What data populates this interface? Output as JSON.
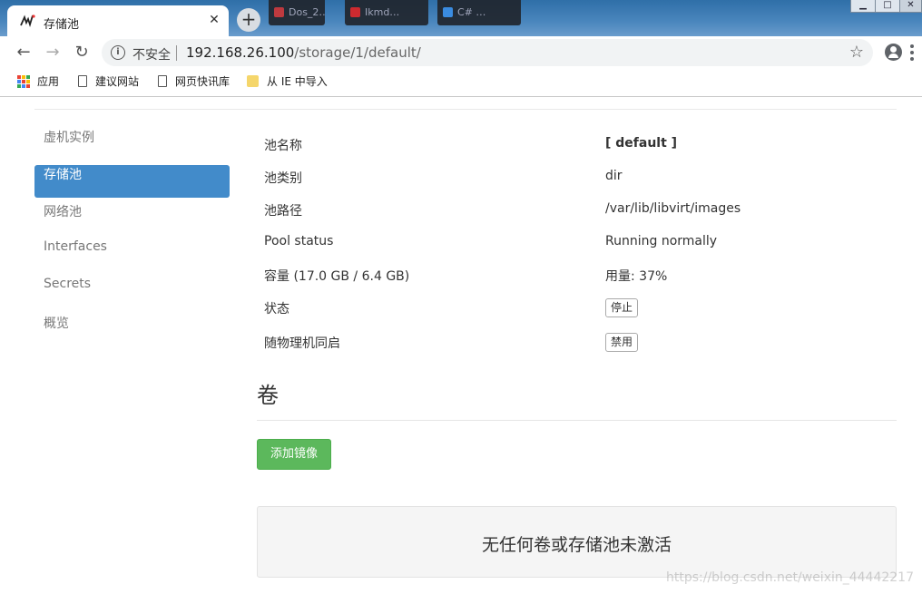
{
  "browser": {
    "tab_title": "存储池",
    "bg_tabs": [
      "Dos_2…",
      "Ikmd…",
      "C# …"
    ],
    "window_controls": [
      "▁",
      "□",
      "✕"
    ],
    "new_tab_label": "+",
    "address_security": "不安全",
    "address_host": "192.168.26.100",
    "address_path": "/storage/1/default/",
    "bookmarks": [
      "应用",
      "建议网站",
      "网页快讯库",
      "从 IE 中导入"
    ],
    "icons": {
      "back": "back-arrow-icon",
      "forward": "forward-arrow-icon",
      "reload": "reload-icon",
      "info": "info-icon",
      "star": "star-icon",
      "account": "account-icon",
      "menu": "menu-icon",
      "apps": "apps-grid-icon"
    }
  },
  "sidebar": {
    "items": [
      {
        "label": "虚机实例",
        "active": false
      },
      {
        "label": "存储池",
        "active": true
      },
      {
        "label": "网络池",
        "active": false
      },
      {
        "label": "Interfaces",
        "active": false
      },
      {
        "label": "Secrets",
        "active": false
      },
      {
        "label": "概览",
        "active": false
      }
    ]
  },
  "pool": {
    "name_label": "池名称",
    "name_value": "[ default ]",
    "type_label": "池类别",
    "type_value": "dir",
    "path_label": "池路径",
    "path_value": "/var/lib/libvirt/images",
    "status_label": "Pool status",
    "status_value": "Running normally",
    "capacity_label": "容量 (17.0 GB / 6.4 GB)",
    "usage_value": "用量: 37%",
    "state_label": "状态",
    "state_button": "停止",
    "autostart_label": "随物理机同启",
    "autostart_button": "禁用"
  },
  "volumes": {
    "title": "卷",
    "add_button": "添加镜像",
    "empty_message": "无任何卷或存储池未激活"
  },
  "watermark": "https://blog.csdn.net/weixin_44442217",
  "colors": {
    "active_nav": "#428bca",
    "add_button": "#5cb85c",
    "empty_box_bg": "#f5f5f5"
  }
}
